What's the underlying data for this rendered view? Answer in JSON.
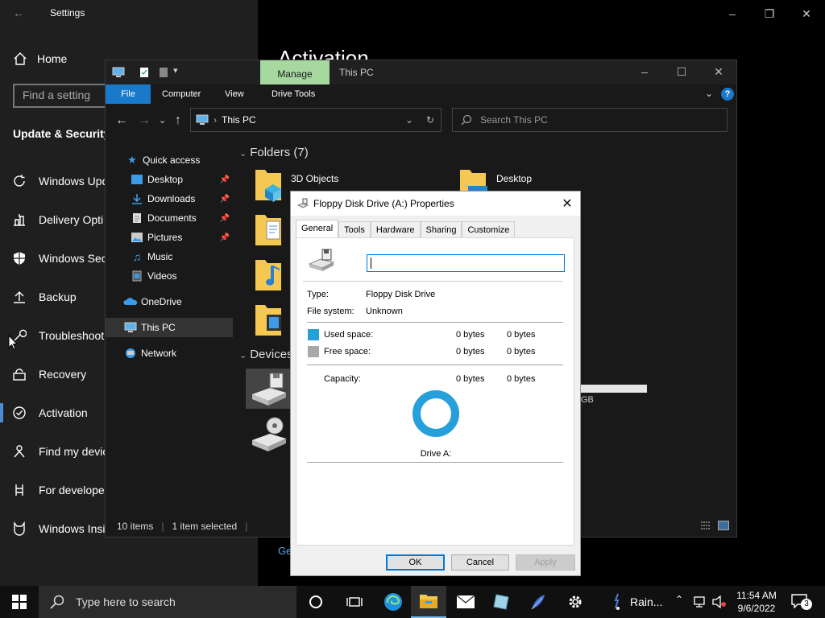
{
  "settings": {
    "title": "Settings",
    "home": "Home",
    "find_placeholder": "Find a setting",
    "section": "Update & Security",
    "items": [
      "Windows Upd",
      "Delivery Opti",
      "Windows Sec",
      "Backup",
      "Troubleshoot",
      "Recovery",
      "Activation",
      "Find my devic",
      "For developer",
      "Windows Insi"
    ],
    "page_title": "Activation",
    "link_partial": "Ge"
  },
  "explorer": {
    "manage_tab": "Manage",
    "title": "This PC",
    "ribbon_tabs": [
      "File",
      "Computer",
      "View",
      "Drive Tools"
    ],
    "address": "This PC",
    "search_placeholder": "Search This PC",
    "nav": {
      "quick_access": "Quick access",
      "desktop": "Desktop",
      "downloads": "Downloads",
      "documents": "Documents",
      "pictures": "Pictures",
      "music": "Music",
      "videos": "Videos",
      "onedrive": "OneDrive",
      "this_pc": "This PC",
      "network": "Network"
    },
    "folders_header": "Folders (7)",
    "folders": [
      "3D Objects",
      "Desktop"
    ],
    "devices_header": "Devices",
    "drive_size_partial": "GB",
    "status": {
      "items": "10 items",
      "selected": "1 item selected"
    }
  },
  "dialog": {
    "title": "Floppy Disk Drive (A:) Properties",
    "tabs": [
      "General",
      "Tools",
      "Hardware",
      "Sharing",
      "Customize"
    ],
    "name_value": "",
    "type_label": "Type:",
    "type_value": "Floppy Disk Drive",
    "fs_label": "File system:",
    "fs_value": "Unknown",
    "used_label": "Used space:",
    "used_bytes": "0 bytes",
    "used_size": "0 bytes",
    "free_label": "Free space:",
    "free_bytes": "0 bytes",
    "free_size": "0 bytes",
    "cap_label": "Capacity:",
    "cap_bytes": "0 bytes",
    "cap_size": "0 bytes",
    "drive_label": "Drive A:",
    "ok": "OK",
    "cancel": "Cancel",
    "apply": "Apply",
    "colors": {
      "used": "#26a0da",
      "free": "#a8a8a8"
    }
  },
  "taskbar": {
    "search_placeholder": "Type here to search",
    "weather": "Rain...",
    "time": "11:54 AM",
    "date": "9/6/2022",
    "notifications": "3"
  }
}
